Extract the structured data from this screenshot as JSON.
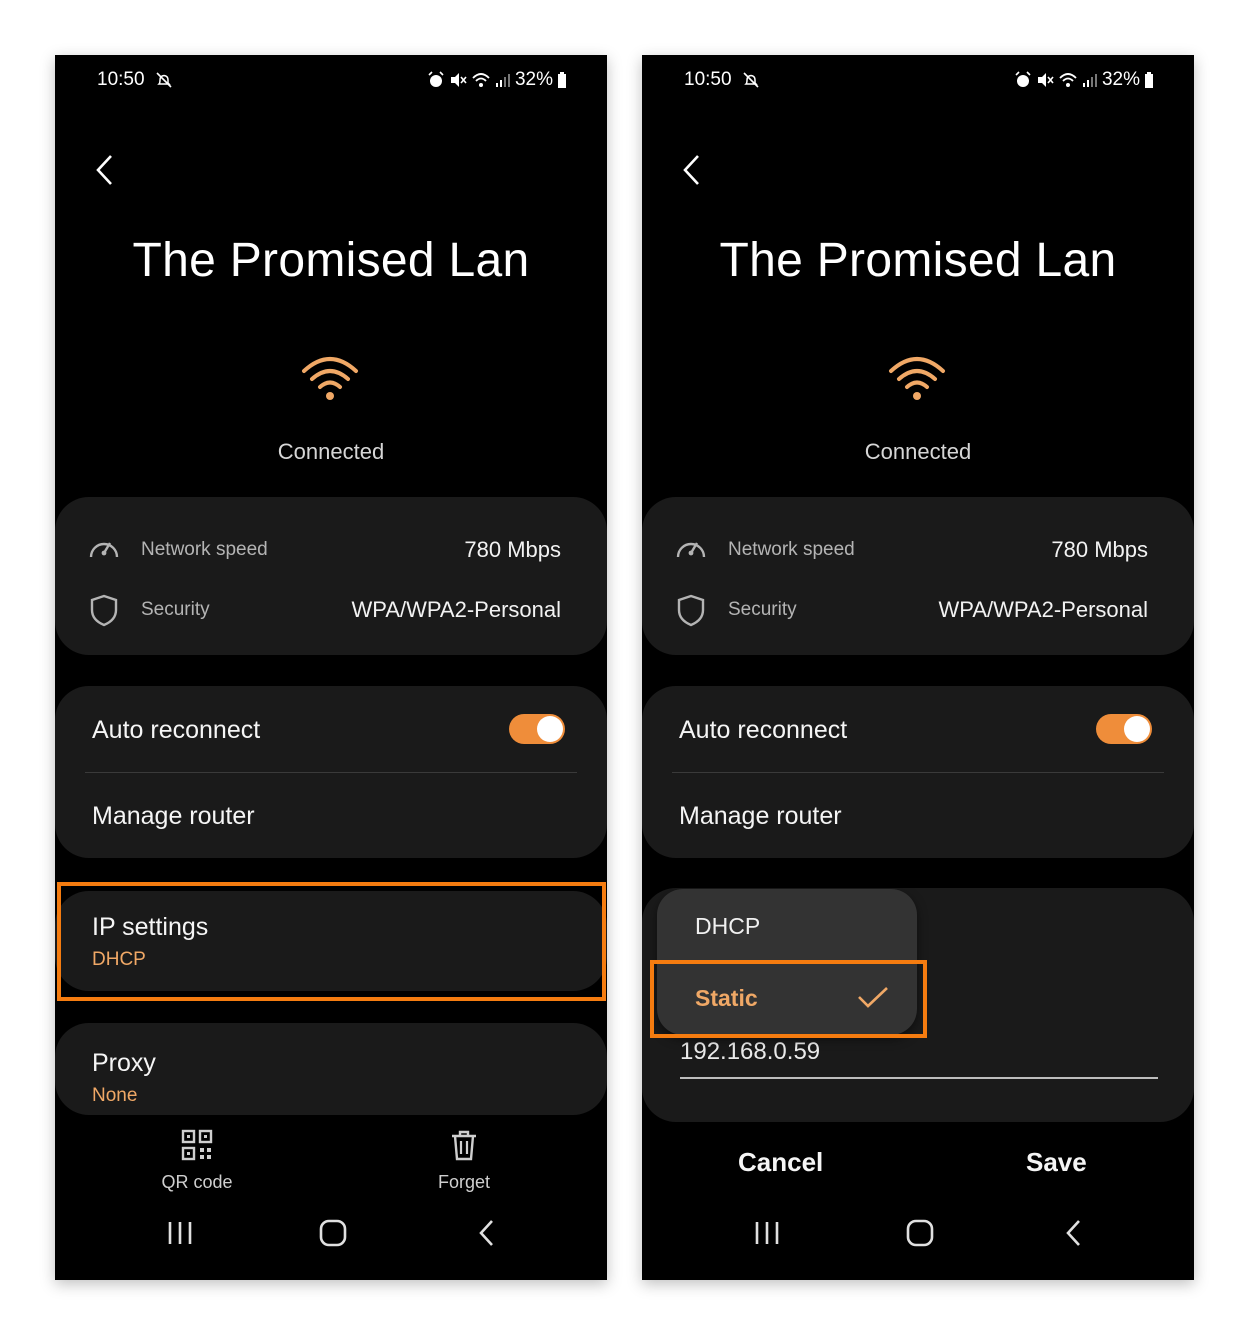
{
  "status_bar": {
    "time": "10:50",
    "battery": "32%"
  },
  "network": {
    "name": "The Promised Lan",
    "status": "Connected",
    "speed_label": "Network speed",
    "speed_value": "780 Mbps",
    "security_label": "Security",
    "security_value": "WPA/WPA2-Personal"
  },
  "settings": {
    "auto_reconnect_label": "Auto reconnect",
    "auto_reconnect_on": true,
    "manage_router_label": "Manage router",
    "ip_settings_label": "IP settings",
    "ip_settings_value": "DHCP",
    "proxy_label": "Proxy",
    "proxy_value": "None"
  },
  "actions": {
    "qr_code": "QR code",
    "forget": "Forget"
  },
  "ip_dropdown": {
    "options": [
      "DHCP",
      "Static"
    ],
    "selected": "Static",
    "ip_address": "192.168.0.59"
  },
  "dialog": {
    "cancel": "Cancel",
    "save": "Save"
  },
  "colors": {
    "accent": "#f0a866",
    "toggle": "#ef8d3a",
    "highlight": "#f57c10",
    "card": "#1a1a1a"
  }
}
